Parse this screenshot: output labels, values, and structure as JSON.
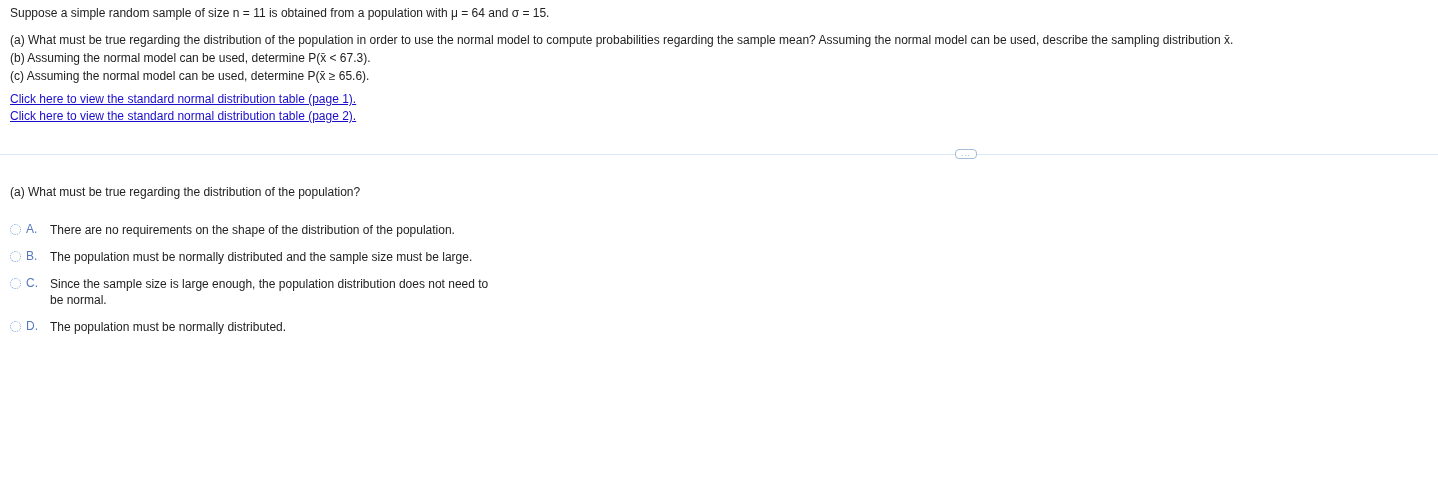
{
  "intro": "Suppose a simple random sample of size n = 11 is obtained from a population with μ = 64 and σ = 15.",
  "parts": [
    "(a) What must be true regarding the distribution of the population in order to use the normal model to compute probabilities regarding the sample mean? Assuming the normal model can be used, describe the sampling distribution x̄.",
    "(b) Assuming the normal model can be used, determine P(x̄ < 67.3).",
    "(c) Assuming the normal model can be used, determine P(x̄ ≥ 65.6)."
  ],
  "links": [
    "Click here to view the standard normal distribution table (page 1).",
    "Click here to view the standard normal distribution table (page 2)."
  ],
  "expand_button": "...",
  "question": "(a) What must be true regarding the distribution of the population?",
  "options": [
    {
      "letter": "A.",
      "text": "There are no requirements on the shape of the distribution of the population.",
      "selected": false
    },
    {
      "letter": "B.",
      "text": "The population must be normally distributed and the sample size must be large.",
      "selected": false
    },
    {
      "letter": "C.",
      "text": "Since the sample size is large enough, the population distribution does not need to be normal.",
      "selected": false
    },
    {
      "letter": "D.",
      "text": "The population must be normally distributed.",
      "selected": false
    }
  ]
}
